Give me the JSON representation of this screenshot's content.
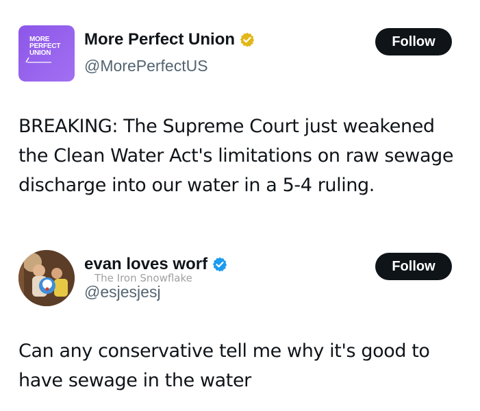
{
  "tweet1": {
    "logo_lines": [
      "MORE",
      "PERFECT",
      "UNION"
    ],
    "display_name": "More Perfect Union",
    "verified_icon": "gold-verified-badge-icon",
    "handle": "@MorePerfectUS",
    "follow_label": "Follow",
    "text": "BREAKING: The Supreme Court just weakened the Clean Water Act's limitations on raw sewage discharge into our water in a 5-4 ruling."
  },
  "tweet2": {
    "display_name": "evan loves worf",
    "verified_icon": "blue-verified-badge-icon",
    "handle": "@esjesjesj",
    "follow_label": "Follow",
    "watermark": "The Iron Snowflake",
    "text": "Can any conservative tell me why it's good to have sewage in the water"
  },
  "colors": {
    "gold_badge": "#e2b719",
    "blue_badge": "#1d9bf0",
    "logo_purple": "#9461ee",
    "button": "#0f1419"
  }
}
